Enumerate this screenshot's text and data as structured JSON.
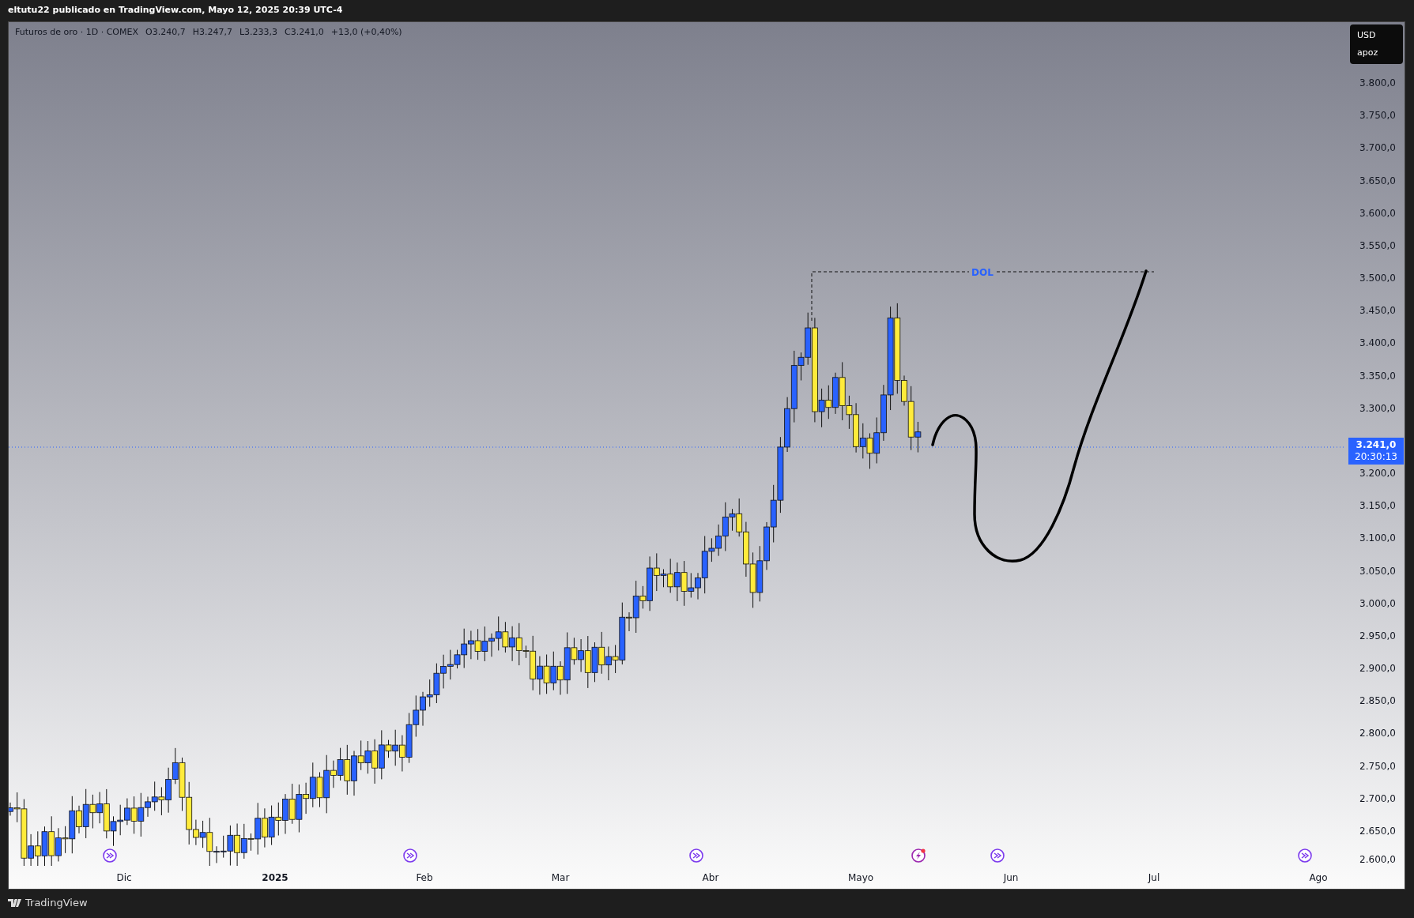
{
  "header": {
    "text": "eltutu22 publicado en TradingView.com, Mayo 12, 2025 20:39 UTC-4"
  },
  "legend": {
    "symbol": "Futuros de oro · 1D · COMEX",
    "open": "O3.240,7",
    "high": "H3.247,7",
    "low": "L3.233,3",
    "close": "C3.241,0",
    "change": "+13,0 (+0,40%)"
  },
  "currency_box": {
    "currency": "USD",
    "unit": "apoz"
  },
  "price_axis": [
    "3.800,0",
    "3.750,0",
    "3.700,0",
    "3.650,0",
    "3.600,0",
    "3.550,0",
    "3.500,0",
    "3.450,0",
    "3.400,0",
    "3.350,0",
    "3.300,0",
    "3.200,0",
    "3.150,0",
    "3.100,0",
    "3.050,0",
    "3.000,0",
    "2.950,0",
    "2.900,0",
    "2.850,0",
    "2.800,0",
    "2.750,0",
    "2.700,0",
    "2.650,0",
    "2.600,0"
  ],
  "last_price": {
    "price": "3.241,0",
    "countdown": "20:30:13"
  },
  "annotation": {
    "label": "DOL"
  },
  "time_axis": [
    {
      "label": "Dic",
      "bold": false
    },
    {
      "label": "2025",
      "bold": true
    },
    {
      "label": "Feb",
      "bold": false
    },
    {
      "label": "Mar",
      "bold": false
    },
    {
      "label": "Abr",
      "bold": false
    },
    {
      "label": "Mayo",
      "bold": false
    },
    {
      "label": "Jun",
      "bold": false
    },
    {
      "label": "Jul",
      "bold": false
    },
    {
      "label": "Ago",
      "bold": false
    }
  ],
  "footer": {
    "brand": "TradingView"
  }
}
